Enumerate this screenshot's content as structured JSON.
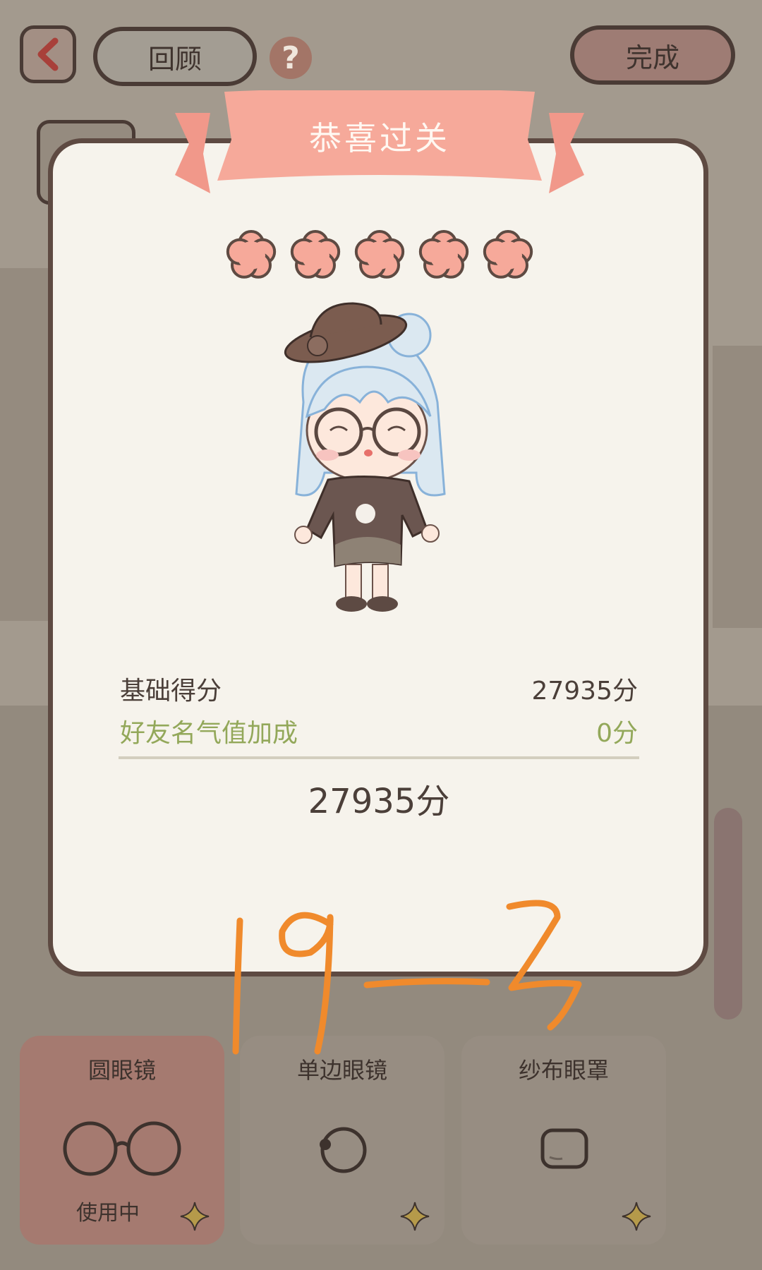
{
  "header": {
    "review_label": "回顾",
    "done_label": "完成",
    "help_symbol": "?"
  },
  "dialog": {
    "title": "恭喜过关",
    "stars_earned": 5,
    "stars_total": 5,
    "base_score_label": "基础得分",
    "base_score_value": "27935分",
    "friend_bonus_label": "好友名气值加成",
    "friend_bonus_value": "0分",
    "total_score": "27935分"
  },
  "handwritten_annotation": "19-2",
  "items": [
    {
      "name": "圆眼镜",
      "status": "使用中",
      "icon": "round-glasses-icon"
    },
    {
      "name": "单边眼镜",
      "status": "",
      "icon": "monocle-icon"
    },
    {
      "name": "纱布眼罩",
      "status": "",
      "icon": "gauze-eyepatch-icon"
    }
  ],
  "colors": {
    "accent_pink": "#f6a99a",
    "bonus_green": "#93a85a",
    "outline_brown": "#5e4a42",
    "annotation_orange": "#f08a2c"
  }
}
